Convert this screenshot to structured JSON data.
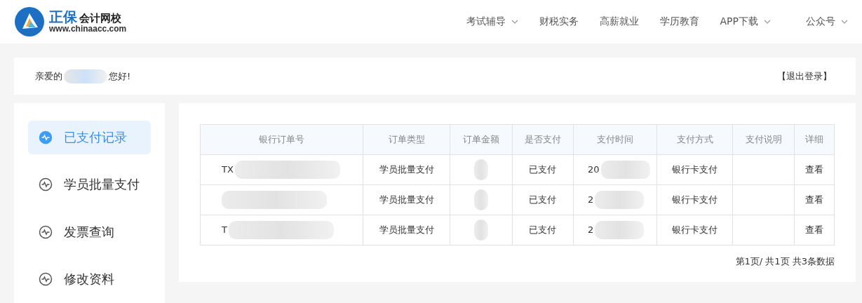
{
  "logo": {
    "brand": "正保",
    "name": "会计网校",
    "url": "www.chinaacc.com"
  },
  "nav": [
    {
      "label": "考试辅导",
      "dropdown": true
    },
    {
      "label": "财税实务",
      "dropdown": false
    },
    {
      "label": "高薪就业",
      "dropdown": false
    },
    {
      "label": "学历教育",
      "dropdown": false
    },
    {
      "label": "APP下载",
      "dropdown": true
    },
    {
      "label": "公众号",
      "dropdown": true
    }
  ],
  "greeting": {
    "prefix": "亲爱的",
    "suffix": "您好!",
    "logout": "【退出登录】"
  },
  "sidebar": {
    "items": [
      {
        "label": "已支付记录",
        "selected": true
      },
      {
        "label": "学员批量支付",
        "selected": false
      },
      {
        "label": "发票查询",
        "selected": false
      },
      {
        "label": "修改资料",
        "selected": false
      }
    ]
  },
  "table": {
    "columns": [
      "银行订单号",
      "订单类型",
      "订单金额",
      "是否支付",
      "支付时间",
      "支付方式",
      "支付说明",
      "详细"
    ],
    "rows": [
      [
        "TX",
        "学员批量支付",
        "",
        "已支付",
        "20",
        "银行卡支付",
        "",
        "查看"
      ],
      [
        "",
        "学员批量支付",
        "",
        "已支付",
        "2",
        "银行卡支付",
        "",
        "查看"
      ],
      [
        "T",
        "学员批量支付",
        "",
        "已支付",
        "2",
        "银行卡支付",
        "",
        "查看"
      ]
    ]
  },
  "pagination": "第1页/ 共1页 共3条数据"
}
